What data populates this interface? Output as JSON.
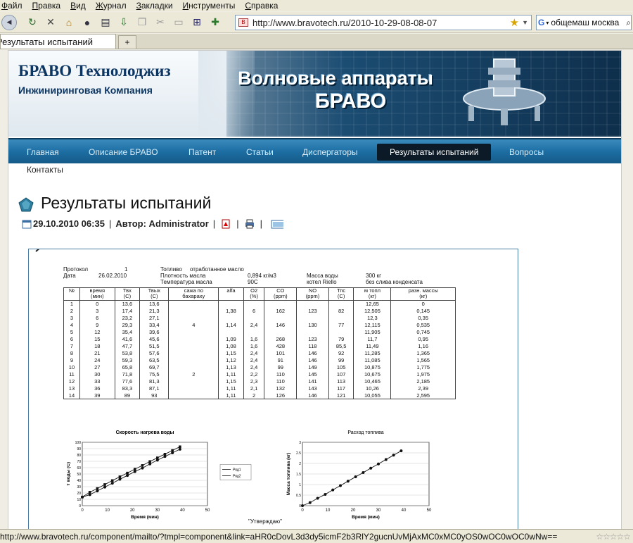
{
  "browser": {
    "menu": [
      "Файл",
      "Правка",
      "Вид",
      "Журнал",
      "Закладки",
      "Инструменты",
      "Справка"
    ],
    "url": "http://www.bravotech.ru/2010-10-29-08-08-07",
    "search_value": "общемаш москва",
    "tab_title": "Результаты испытаний",
    "new_tab": "+",
    "status_text": "http://www.bravotech.ru/component/mailto/?tmpl=component&link=aHR0cDovL3d3dy5icmF2b3RlY2gucnUvMjAxMC0xMC0yOS0wOC0wOC0wNw=="
  },
  "header": {
    "logo_title": "БРАВО Технолоджиз",
    "logo_sub": "Инжиниринговая Компания",
    "banner_line1": "Волновые аппараты",
    "banner_line2": "БРАВО"
  },
  "nav": {
    "items": [
      "Главная",
      "Описание БРАВО",
      "Патент",
      "Статьи",
      "Диспергаторы",
      "Результаты испытаний",
      "Вопросы"
    ],
    "second_row": "Контакты",
    "active_index": 5
  },
  "article": {
    "title": "Результаты испытаний",
    "date": "29.10.2010 06:35",
    "author": "Автор: Administrator"
  },
  "document": {
    "protocol": {
      "protocol_label": "Протокол",
      "protocol_value": "1",
      "date_label": "Дата",
      "date_value": "26.02.2010",
      "fuel_label": "Топливо",
      "fuel_value": "отработанное масло",
      "density_label": "Плотность масла",
      "density_value": "0,894 кг/м3",
      "oil_temp_label": "Температура масла",
      "oil_temp_value": "90С",
      "water_label": "Масса воды",
      "water_value": "300 кг",
      "boiler_label": "котел Riello",
      "condensate": "без слива конденсата"
    },
    "table": {
      "headers": [
        [
          "№",
          ""
        ],
        [
          "время",
          "(мин)"
        ],
        [
          "Твх",
          "(С)"
        ],
        [
          "Твых",
          "(С)"
        ],
        [
          "сажа по",
          "бахараху"
        ],
        [
          "alfa",
          ""
        ],
        [
          "О2",
          "(%)"
        ],
        [
          "СО",
          "(ppm)"
        ],
        [
          "NO",
          "(ppm)"
        ],
        [
          "Тпс",
          "(С)"
        ],
        [
          "м топл",
          "(кг)"
        ],
        [
          "разн. массы",
          "(кг)"
        ]
      ],
      "rows": [
        [
          "1",
          "0",
          "13,6",
          "13,6",
          "",
          "",
          "",
          "",
          "",
          "",
          "12,65",
          "0"
        ],
        [
          "2",
          "3",
          "17,4",
          "21,3",
          "",
          "1,38",
          "6",
          "162",
          "123",
          "82",
          "12,505",
          "0,145"
        ],
        [
          "3",
          "6",
          "23,2",
          "27,1",
          "",
          "",
          "",
          "",
          "",
          "",
          "12,3",
          "0,35"
        ],
        [
          "4",
          "9",
          "29,3",
          "33,4",
          "4",
          "1,14",
          "2,4",
          "146",
          "130",
          "77",
          "12,115",
          "0,535"
        ],
        [
          "5",
          "12",
          "35,4",
          "39,6",
          "",
          "",
          "",
          "",
          "",
          "",
          "11,905",
          "0,745"
        ],
        [
          "6",
          "15",
          "41,6",
          "45,6",
          "",
          "1,09",
          "1,6",
          "268",
          "123",
          "79",
          "11,7",
          "0,95"
        ],
        [
          "7",
          "18",
          "47,7",
          "51,5",
          "",
          "1,08",
          "1,6",
          "428",
          "118",
          "85,5",
          "11,49",
          "1,16"
        ],
        [
          "8",
          "21",
          "53,8",
          "57,6",
          "",
          "1,15",
          "2,4",
          "101",
          "146",
          "92",
          "11,285",
          "1,365"
        ],
        [
          "9",
          "24",
          "59,3",
          "63,5",
          "",
          "1,12",
          "2,4",
          "91",
          "146",
          "99",
          "11,085",
          "1,565"
        ],
        [
          "10",
          "27",
          "65,8",
          "69,7",
          "",
          "1,13",
          "2,4",
          "99",
          "149",
          "105",
          "10,875",
          "1,775"
        ],
        [
          "11",
          "30",
          "71,8",
          "75,5",
          "2",
          "1,11",
          "2,2",
          "110",
          "145",
          "107",
          "10,675",
          "1,975"
        ],
        [
          "12",
          "33",
          "77,6",
          "81,3",
          "",
          "1,15",
          "2,3",
          "110",
          "141",
          "113",
          "10,465",
          "2,185"
        ],
        [
          "13",
          "36",
          "83,3",
          "87,1",
          "",
          "1,11",
          "2,1",
          "132",
          "143",
          "117",
          "10,26",
          "2,39"
        ],
        [
          "14",
          "39",
          "89",
          "93",
          "",
          "1,11",
          "2",
          "126",
          "146",
          "121",
          "10,055",
          "2,595"
        ]
      ]
    },
    "bottom_note": "\"Утверждаю\""
  },
  "chart_data": [
    {
      "type": "line",
      "title": "Скорость нагрева воды",
      "xlabel": "Время (мин)",
      "ylabel": "Т воды (С)",
      "xlim": [
        0,
        50
      ],
      "ylim": [
        0,
        100
      ],
      "xticks": [
        0,
        10,
        20,
        30,
        40,
        50
      ],
      "yticks": [
        0,
        10,
        20,
        30,
        40,
        50,
        60,
        70,
        80,
        90,
        100
      ],
      "x": [
        0,
        3,
        6,
        9,
        12,
        15,
        18,
        21,
        24,
        27,
        30,
        33,
        36,
        39
      ],
      "series": [
        {
          "name": "Ряд1",
          "values": [
            13.6,
            17.4,
            23.2,
            29.3,
            35.4,
            41.6,
            47.7,
            53.8,
            59.3,
            65.8,
            71.8,
            77.6,
            83.3,
            89
          ]
        },
        {
          "name": "Ряд2",
          "values": [
            13.6,
            21.3,
            27.1,
            33.4,
            39.6,
            45.6,
            51.5,
            57.6,
            63.5,
            69.7,
            75.5,
            81.3,
            87.1,
            93
          ]
        }
      ],
      "legend": "right"
    },
    {
      "type": "line",
      "title": "Расход топлива",
      "xlabel": "Время (мин)",
      "ylabel": "Масса топлива (кг)",
      "xlim": [
        0,
        50
      ],
      "ylim": [
        0,
        3
      ],
      "xticks": [
        0,
        10,
        20,
        30,
        40,
        50
      ],
      "yticks": [
        0,
        0.5,
        1,
        1.5,
        2,
        2.5,
        3
      ],
      "x": [
        0,
        3,
        6,
        9,
        12,
        15,
        18,
        21,
        24,
        27,
        30,
        33,
        36,
        39
      ],
      "series": [
        {
          "values": [
            0,
            0.145,
            0.35,
            0.535,
            0.745,
            0.95,
            1.16,
            1.365,
            1.565,
            1.775,
            1.975,
            2.185,
            2.39,
            2.595
          ]
        }
      ]
    }
  ]
}
